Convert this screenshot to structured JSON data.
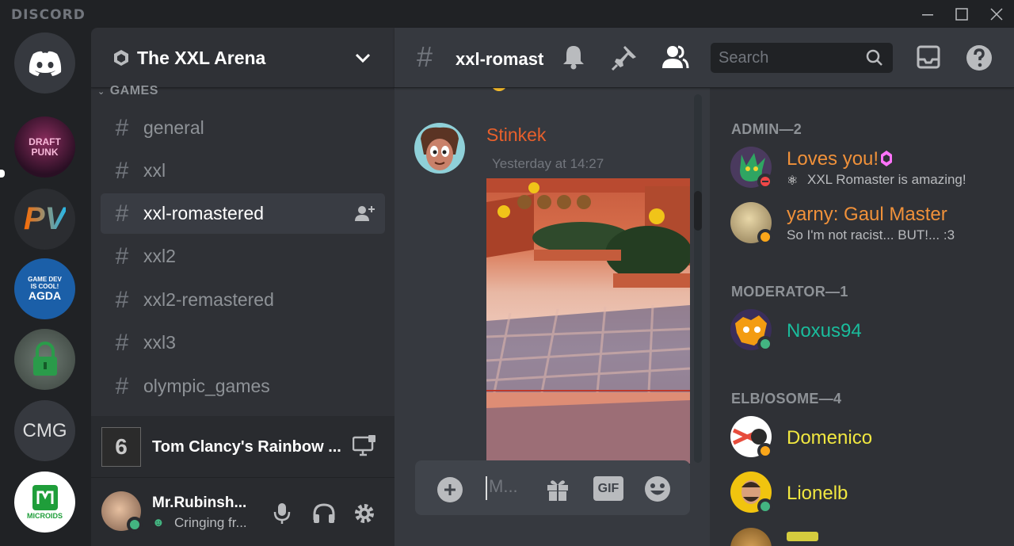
{
  "app": {
    "brand": "DISCORD"
  },
  "servers": [
    {
      "label": "DRAFT PUNK"
    },
    {
      "label": "PV"
    },
    {
      "label_top": "GAME DEV",
      "label_mid": "IS COOL!",
      "label_main": "AGDA"
    },
    {
      "label": "lock"
    },
    {
      "label": "CMG"
    },
    {
      "label": "MICROIDS"
    }
  ],
  "guild": {
    "name": "The XXL Arena",
    "category": "GAMES",
    "channels": [
      {
        "name": "general"
      },
      {
        "name": "xxl"
      },
      {
        "name": "xxl-romastered"
      },
      {
        "name": "xxl2"
      },
      {
        "name": "xxl2-remastered"
      },
      {
        "name": "xxl3"
      },
      {
        "name": "olympic_games"
      }
    ]
  },
  "activity": {
    "title": "Tom Clancy's Rainbow ...",
    "logo_text": "6"
  },
  "user": {
    "name": "Mr.Rubinsh...",
    "status": "Cringing fr..."
  },
  "header": {
    "channel": "xxl-romast",
    "search_placeholder": "Search"
  },
  "message": {
    "author": "Stinkek",
    "timestamp": "Yesterday at 14:27",
    "author_color": "#e8602c"
  },
  "composer": {
    "placeholder": "M...",
    "gif": "GIF"
  },
  "member_groups": [
    {
      "title": "ADMIN—2",
      "members": [
        {
          "name": "Loves you!",
          "status": "XXL Romaster is amazing!",
          "color": "#f0913a"
        },
        {
          "name": "yarny: Gaul Master",
          "status": "So I'm not racist... BUT!... :3",
          "color": "#f0913a"
        }
      ]
    },
    {
      "title": "MODERATOR—1",
      "members": [
        {
          "name": "Noxus94",
          "color": "#1abc9c"
        }
      ]
    },
    {
      "title": "ELB/OSOME—4",
      "members": [
        {
          "name": "Domenico",
          "color": "#f1e740"
        },
        {
          "name": "Lionelb",
          "color": "#f1e740"
        }
      ]
    }
  ]
}
